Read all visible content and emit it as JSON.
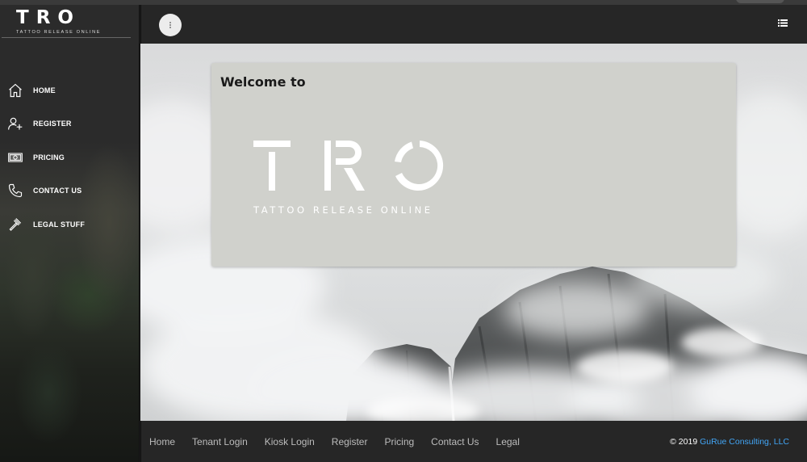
{
  "brand": {
    "logo_text": "TRO",
    "tagline": "TATTOO RELEASE ONLINE"
  },
  "sidebar": {
    "items": [
      {
        "label": "HOME",
        "icon": "home-icon"
      },
      {
        "label": "REGISTER",
        "icon": "add-user-icon"
      },
      {
        "label": "PRICING",
        "icon": "money-icon"
      },
      {
        "label": "CONTACT US",
        "icon": "phone-icon"
      },
      {
        "label": "LEGAL STUFF",
        "icon": "gavel-icon"
      }
    ]
  },
  "topbar": {
    "menu_icon": "more-vertical-icon",
    "list_icon": "list-view-icon"
  },
  "main": {
    "welcome_title": "Welcome to",
    "logo_text": "TRO",
    "logo_tagline": "TATTOO RELEASE ONLINE"
  },
  "footer": {
    "links": [
      "Home",
      "Tenant Login",
      "Kiosk Login",
      "Register",
      "Pricing",
      "Contact Us",
      "Legal"
    ],
    "copyright_prefix": "© 2019 ",
    "copyright_company": "GuRue Consulting, LLC"
  },
  "colors": {
    "dark": "#262626",
    "card": "#d0d1cc",
    "link_accent": "#42a5f5"
  }
}
